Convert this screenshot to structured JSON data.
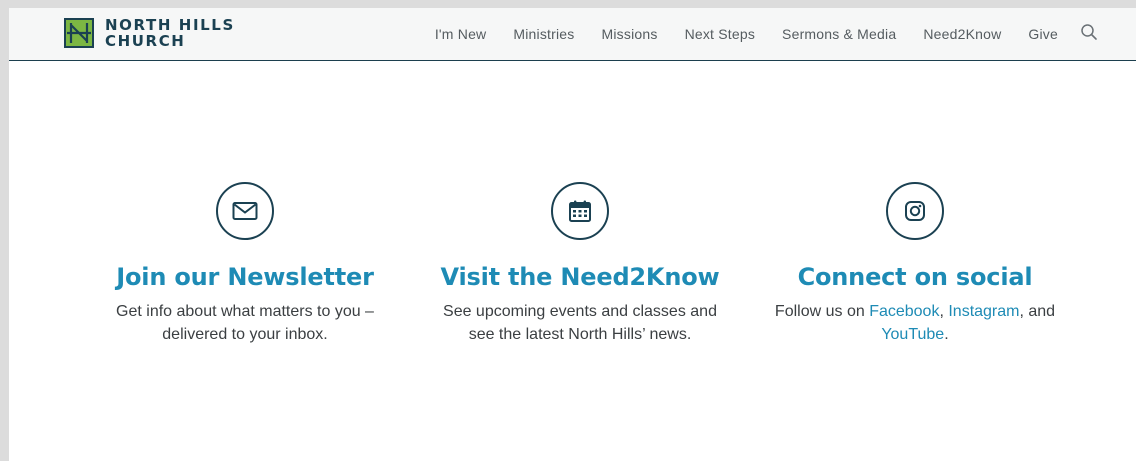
{
  "header": {
    "logo": {
      "line1": "NORTH HILLS",
      "line2": "CHURCH",
      "mark_letter": "N"
    },
    "nav": [
      {
        "label": "I'm New"
      },
      {
        "label": "Ministries"
      },
      {
        "label": "Missions"
      },
      {
        "label": "Next Steps"
      },
      {
        "label": "Sermons & Media"
      },
      {
        "label": "Need2Know"
      },
      {
        "label": "Give"
      }
    ],
    "search_icon": "search-icon"
  },
  "features": [
    {
      "icon": "envelope-icon",
      "title": "Join our Newsletter",
      "line1": "Get info about what matters to you –",
      "line2": "delivered to your inbox."
    },
    {
      "icon": "calendar-icon",
      "title": "Visit the Need2Know",
      "line1": "See upcoming events and classes and",
      "line2": "see the latest North Hills’ news."
    },
    {
      "icon": "instagram-icon",
      "title": "Connect on social",
      "prefix": "Follow us on ",
      "link1": "Facebook",
      "sep1": ", ",
      "link2": "Instagram",
      "sep2": ", and",
      "link3": "YouTube",
      "suffix": "."
    }
  ],
  "colors": {
    "brand_navy": "#1b4152",
    "brand_green": "#7cb743",
    "accent_blue": "#1e8bb5",
    "nav_text": "#555c60",
    "body_text": "#3b3f42"
  }
}
